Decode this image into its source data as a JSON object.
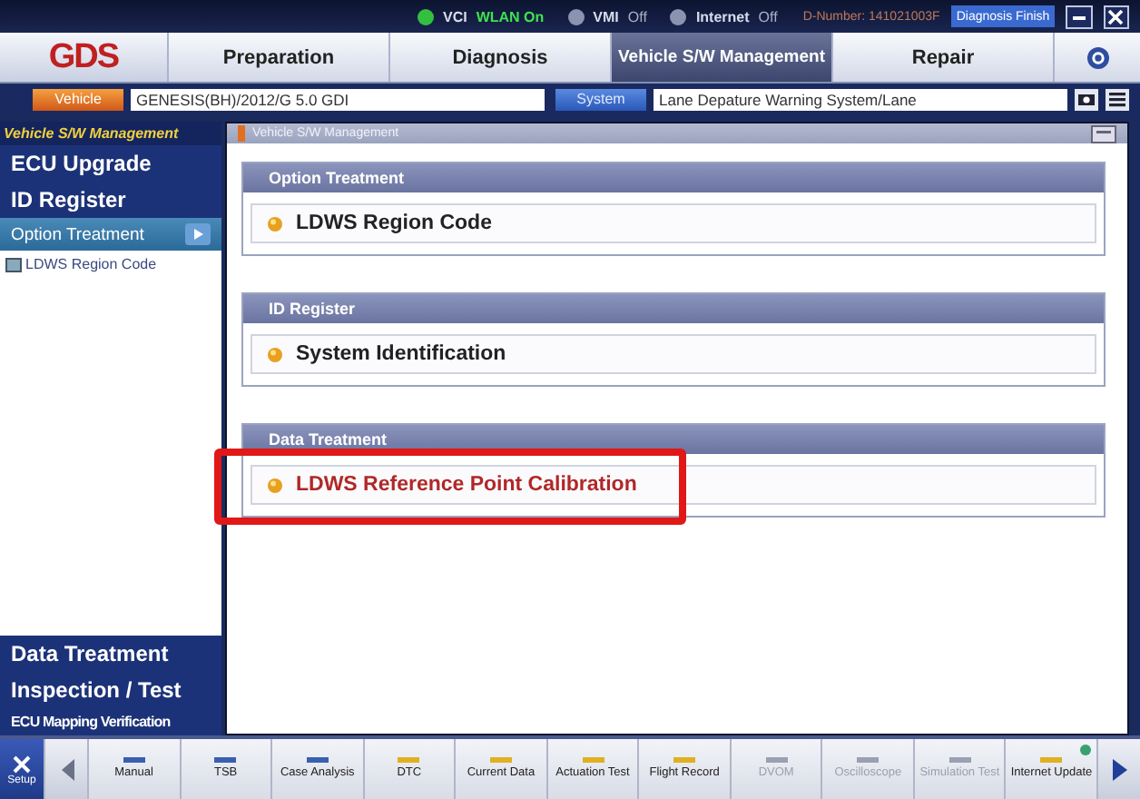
{
  "status_bar": {
    "items": [
      {
        "label": "VCI",
        "kind": "dot",
        "on": true
      },
      {
        "label": "WLAN On",
        "kind": "text",
        "on": true
      },
      {
        "label": "VMI",
        "kind": "dot",
        "on": false
      },
      {
        "label": "Off",
        "kind": "text",
        "on": false
      },
      {
        "label": "Internet",
        "kind": "dot",
        "on": false
      },
      {
        "label": "Off",
        "kind": "text",
        "on": false
      }
    ],
    "d_number": "D-Number: 141021003F",
    "finish_button": "Diagnosis Finish"
  },
  "nav": {
    "logo": "GDS",
    "tabs": [
      {
        "label": "Preparation",
        "selected": false
      },
      {
        "label": "Diagnosis",
        "selected": false
      },
      {
        "label": "Vehicle S/W Management",
        "selected": true
      },
      {
        "label": "Repair",
        "selected": false
      }
    ]
  },
  "vehicle_bar": {
    "vehicle_button": "Vehicle",
    "vehicle": "GENESIS(BH)/2012/G 5.0 GDI",
    "system_button": "System",
    "system": "Lane Depature Warning System/Lane"
  },
  "sidebar": {
    "title": "Vehicle S/W Management",
    "top_items": [
      {
        "label": "ECU Upgrade",
        "kind": "major",
        "selected": false
      },
      {
        "label": "ID Register",
        "kind": "major",
        "selected": false
      },
      {
        "label": "Option Treatment",
        "kind": "minor",
        "selected": true,
        "children": [
          {
            "label": "LDWS Region Code"
          }
        ]
      }
    ],
    "bottom_items": [
      {
        "label": "Data Treatment",
        "kind": "major",
        "selected": false
      },
      {
        "label": "Inspection / Test",
        "kind": "major",
        "selected": false
      },
      {
        "label": "ECU Mapping Verification",
        "kind": "tiny",
        "selected": false
      }
    ]
  },
  "content": {
    "title": "Vehicle S/W Management",
    "groups": [
      {
        "title": "Option Treatment",
        "items": [
          {
            "label": "LDWS Region Code",
            "highlighted": false
          }
        ]
      },
      {
        "title": "ID Register",
        "items": [
          {
            "label": "System Identification",
            "highlighted": false
          }
        ]
      },
      {
        "title": "Data Treatment",
        "items": [
          {
            "label": "LDWS Reference Point Calibration",
            "highlighted": true
          }
        ]
      }
    ]
  },
  "toolbar": {
    "setup": "Setup",
    "items": [
      {
        "label": "Manual",
        "color": "#3a5fb0",
        "disabled": false,
        "notification": false
      },
      {
        "label": "TSB",
        "color": "#3a5fb0",
        "disabled": false,
        "notification": false
      },
      {
        "label": "Case Analysis",
        "color": "#3a5fb0",
        "disabled": false,
        "notification": false
      },
      {
        "label": "DTC",
        "color": "#e0b020",
        "disabled": false,
        "notification": false
      },
      {
        "label": "Current Data",
        "color": "#e0b020",
        "disabled": false,
        "notification": false
      },
      {
        "label": "Actuation Test",
        "color": "#e0b020",
        "disabled": false,
        "notification": false
      },
      {
        "label": "Flight Record",
        "color": "#e0b020",
        "disabled": false,
        "notification": false
      },
      {
        "label": "DVOM",
        "color": "#9aa0b0",
        "disabled": true,
        "notification": false
      },
      {
        "label": "Oscilloscope",
        "color": "#9aa0b0",
        "disabled": true,
        "notification": false
      },
      {
        "label": "Simulation Test",
        "color": "#9aa0b0",
        "disabled": true,
        "notification": false
      },
      {
        "label": "Internet Update",
        "color": "#e0b020",
        "disabled": false,
        "notification": true
      }
    ]
  }
}
